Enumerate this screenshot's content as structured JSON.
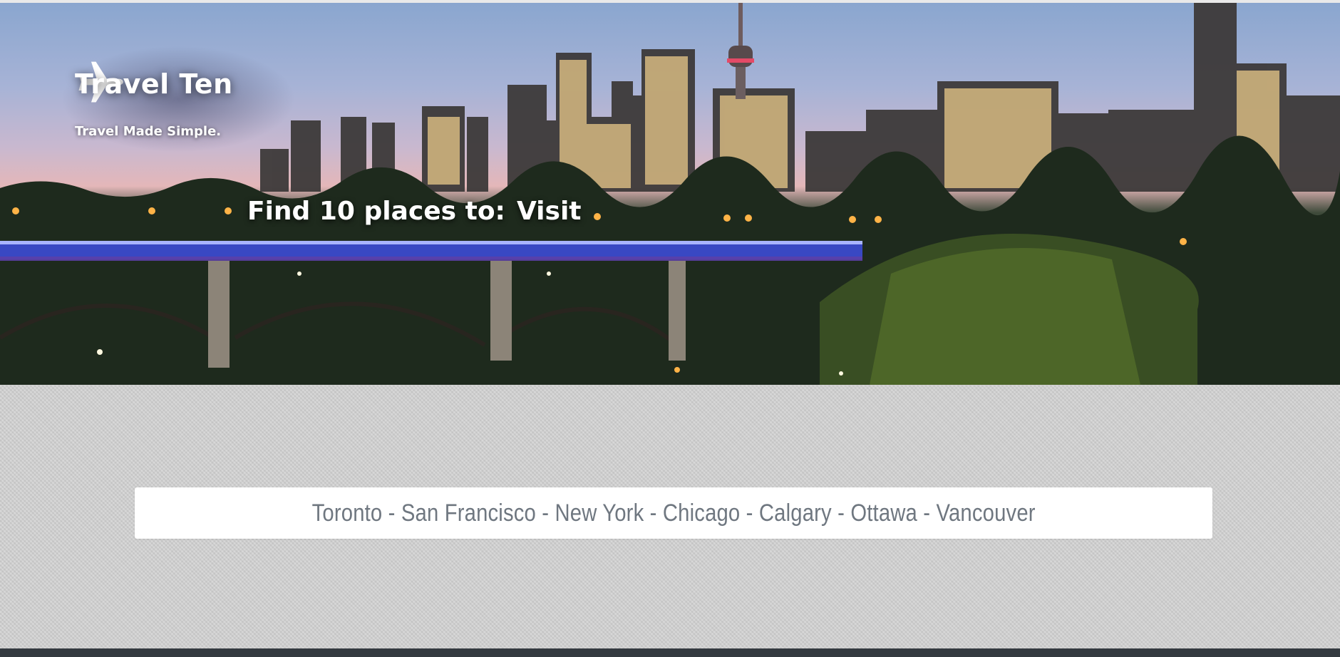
{
  "brand": {
    "title": "Travel Ten",
    "tagline": "Travel Made Simple.",
    "icon": "airplane-icon"
  },
  "hero": {
    "find_prefix": "Find 10 places to:",
    "find_action": "Visit"
  },
  "cities": {
    "text": "Toronto - San Francisco - New York - Chicago - Calgary - Ottawa - Vancouver"
  },
  "colors": {
    "footer": "#343a40",
    "content_bg": "#d2d2d2",
    "cities_text": "#6f7780"
  }
}
